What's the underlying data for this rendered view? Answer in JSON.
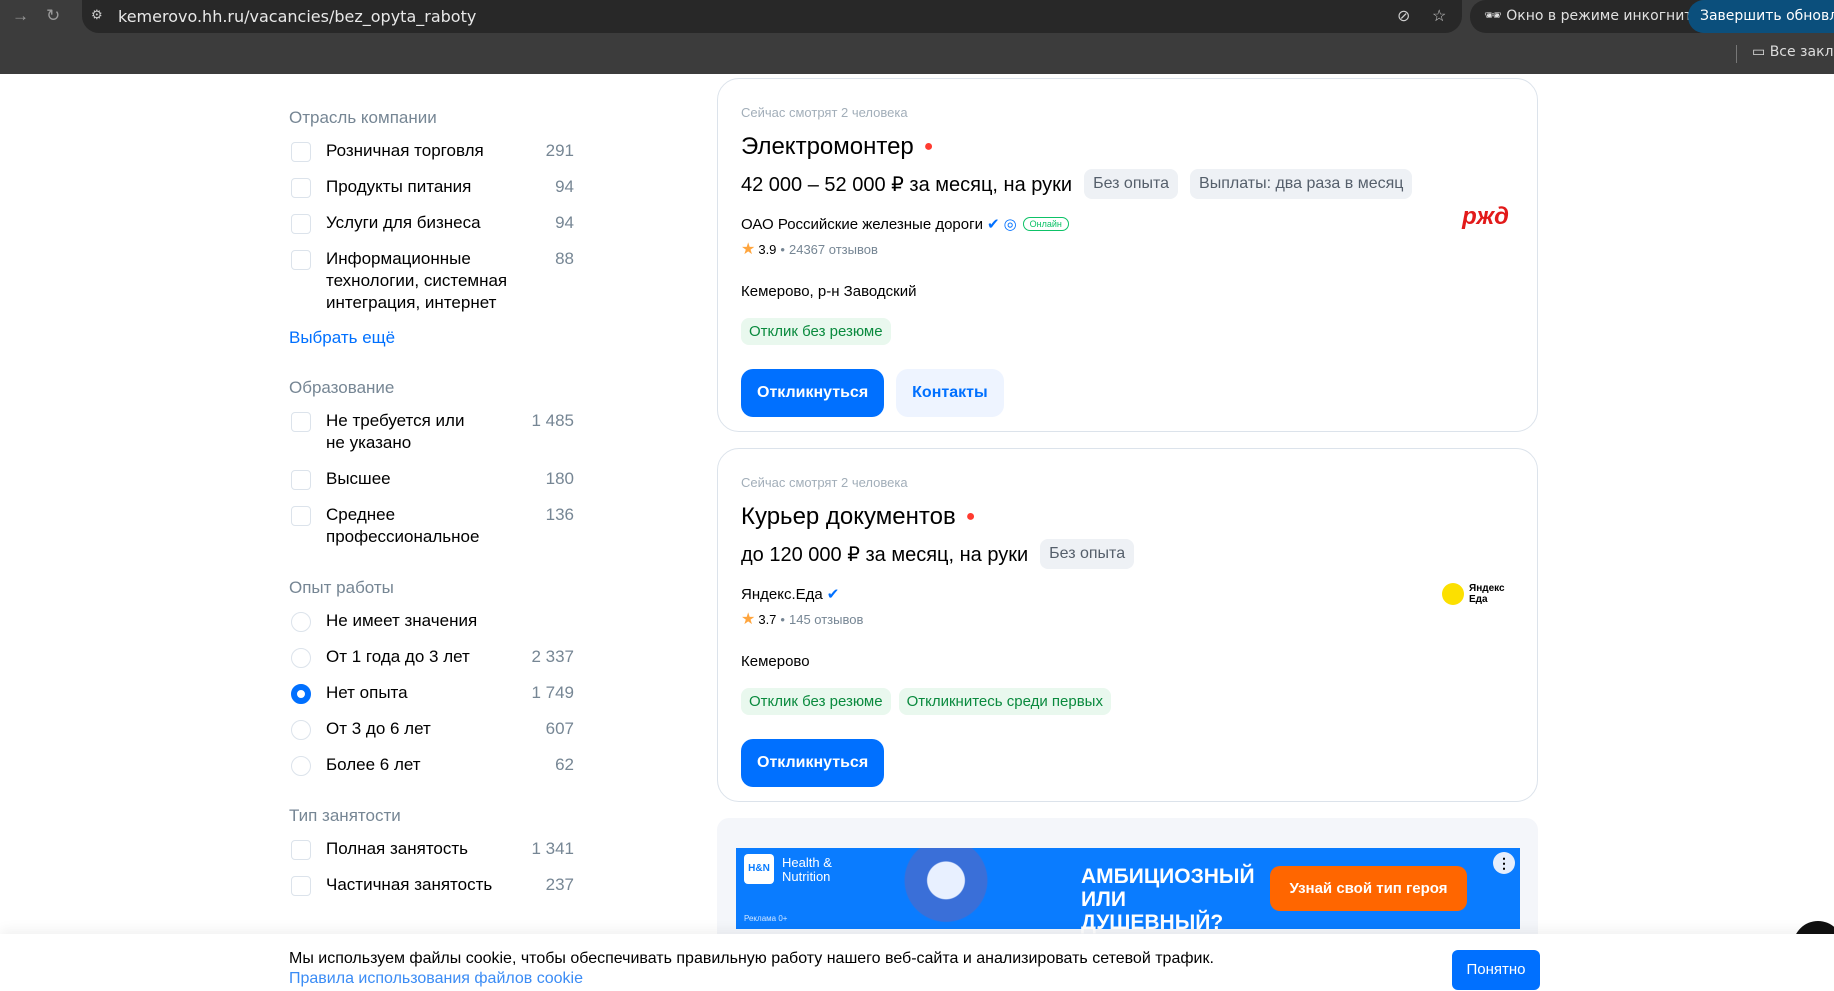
{
  "browser": {
    "url": "kemerovo.hh.ru/vacancies/bez_opyta_raboty",
    "incognito_label": "Окно в режиме инкогнито",
    "update_label": "Завершить обновление",
    "bookmarks_label": "Все закладки"
  },
  "sidebar": {
    "industry": {
      "title": "Отрасль компании",
      "items": [
        {
          "label": "Розничная торговля",
          "count": "291"
        },
        {
          "label": "Продукты питания",
          "count": "94"
        },
        {
          "label": "Услуги для бизнеса",
          "count": "94"
        },
        {
          "label": "Информационные технологии, системная интеграция, интернет",
          "count": "88"
        }
      ],
      "more": "Выбрать ещё"
    },
    "education": {
      "title": "Образование",
      "items": [
        {
          "label": "Не требуется или не указано",
          "count": "1 485"
        },
        {
          "label": "Высшее",
          "count": "180"
        },
        {
          "label": "Среднее профессиональное",
          "count": "136"
        }
      ]
    },
    "experience": {
      "title": "Опыт работы",
      "items": [
        {
          "label": "Не имеет значения",
          "count": ""
        },
        {
          "label": "От 1 года до 3 лет",
          "count": "2 337"
        },
        {
          "label": "Нет опыта",
          "count": "1 749",
          "selected": true
        },
        {
          "label": "От 3 до 6 лет",
          "count": "607"
        },
        {
          "label": "Более 6 лет",
          "count": "62"
        }
      ]
    },
    "employment": {
      "title": "Тип занятости",
      "items": [
        {
          "label": "Полная занятость",
          "count": "1 341"
        },
        {
          "label": "Частичная занятость",
          "count": "237"
        }
      ]
    }
  },
  "vacancies": [
    {
      "watching": "Сейчас смотрят 2 человека",
      "title": "Электромонтер",
      "salary": "42 000 – 52 000 ₽ за месяц, на руки",
      "chips": [
        "Без опыта",
        "Выплаты: два раза в месяц"
      ],
      "company": "ОАО Российские железные дороги",
      "online": "Онлайн",
      "rating": "3.9",
      "reviews": "24367 отзывов",
      "location": "Кемерово, р-н Заводский",
      "tags": [
        "Отклик без резюме"
      ],
      "apply": "Откликнуться",
      "contacts": "Контакты",
      "logo": "РЖД"
    },
    {
      "watching": "Сейчас смотрят 2 человека",
      "title": "Курьер документов",
      "salary": "до 120 000 ₽ за месяц, на руки",
      "chips": [
        "Без опыта"
      ],
      "company": "Яндекс.Еда",
      "rating": "3.7",
      "reviews": "145 отзывов",
      "location": "Кемерово",
      "tags": [
        "Отклик без резюме",
        "Откликнитесь среди первых"
      ],
      "apply": "Откликнуться",
      "logo": "Яндекс Еда"
    }
  ],
  "ad": {
    "brand": "Health & Nutrition",
    "brand_logo": "H&N",
    "label": "Реклама 0+",
    "headline": "АМБИЦИОЗНЫЙ ИЛИ ДУШЕВНЫЙ?",
    "cta": "Узнай свой тип героя"
  },
  "cookie": {
    "text": "Мы используем файлы cookie, чтобы обеспечивать правильную работу нашего веб-сайта и анализировать сетевой трафик.",
    "link": "Правила использования файлов cookie",
    "button": "Понятно"
  }
}
